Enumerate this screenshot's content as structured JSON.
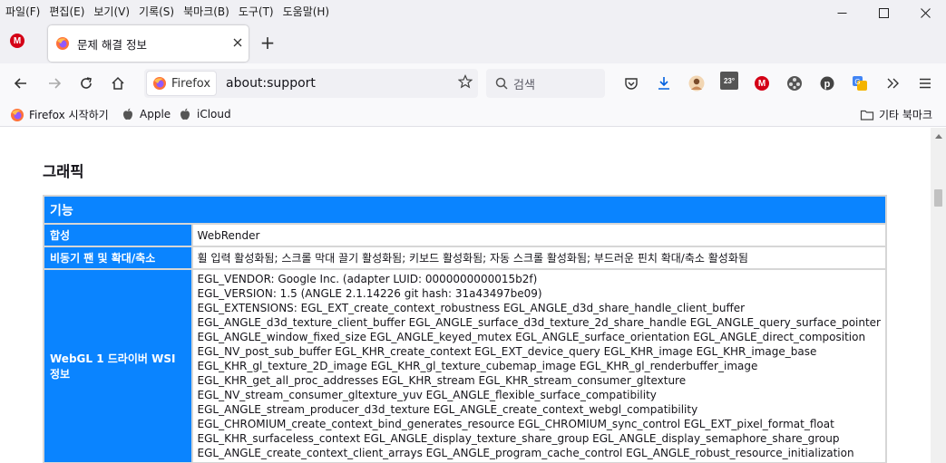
{
  "menu": [
    "파일(F)",
    "편집(E)",
    "보기(V)",
    "기록(S)",
    "북마크(B)",
    "도구(T)",
    "도움말(H)"
  ],
  "window_controls": {
    "minimize": "—",
    "maximize": "☐",
    "close": "✕"
  },
  "tab": {
    "title": "문제 해결 정보",
    "close": "✕"
  },
  "new_tab": "+",
  "nav": {
    "identity_label": "Firefox",
    "url": "about:support",
    "search_placeholder": "검색",
    "weather_badge": "23°"
  },
  "bookmarks": [
    {
      "label": "Firefox 시작하기",
      "icon": "firefox-icon"
    },
    {
      "label": "Apple",
      "icon": "apple-icon"
    },
    {
      "label": "iCloud",
      "icon": "apple-icon"
    }
  ],
  "other_bookmarks": "기타 북마크",
  "content": {
    "heading": "그래픽",
    "section_title": "기능",
    "rows": [
      {
        "label": "합성",
        "value": [
          "WebRender"
        ]
      },
      {
        "label": "비동기 팬 및 확대/축소",
        "value": [
          "휠 입력 활성화됨; 스크롤 막대 끌기 활성화됨; 키보드 활성화됨; 자동 스크롤 활성화됨; 부드러운 핀치 확대/축소 활성화됨"
        ]
      },
      {
        "label": "WebGL 1 드라이버 WSI 정보",
        "value": [
          "EGL_VENDOR: Google Inc. (adapter LUID: 0000000000015b2f)",
          "EGL_VERSION: 1.5 (ANGLE 2.1.14226 git hash: 31a43497be09)",
          "EGL_EXTENSIONS: EGL_EXT_create_context_robustness EGL_ANGLE_d3d_share_handle_client_buffer",
          "EGL_ANGLE_d3d_texture_client_buffer EGL_ANGLE_surface_d3d_texture_2d_share_handle EGL_ANGLE_query_surface_pointer",
          "EGL_ANGLE_window_fixed_size EGL_ANGLE_keyed_mutex EGL_ANGLE_surface_orientation EGL_ANGLE_direct_composition",
          "EGL_NV_post_sub_buffer EGL_KHR_create_context EGL_EXT_device_query EGL_KHR_image EGL_KHR_image_base",
          "EGL_KHR_gl_texture_2D_image EGL_KHR_gl_texture_cubemap_image EGL_KHR_gl_renderbuffer_image",
          "EGL_KHR_get_all_proc_addresses EGL_KHR_stream EGL_KHR_stream_consumer_gltexture",
          "EGL_NV_stream_consumer_gltexture_yuv EGL_ANGLE_flexible_surface_compatibility",
          "EGL_ANGLE_stream_producer_d3d_texture EGL_ANGLE_create_context_webgl_compatibility",
          "EGL_CHROMIUM_create_context_bind_generates_resource EGL_CHROMIUM_sync_control EGL_EXT_pixel_format_float",
          "EGL_KHR_surfaceless_context EGL_ANGLE_display_texture_share_group EGL_ANGLE_display_semaphore_share_group",
          "EGL_ANGLE_create_context_client_arrays EGL_ANGLE_program_cache_control EGL_ANGLE_robust_resource_initialization"
        ]
      }
    ]
  },
  "colors": {
    "accent": "#0a84ff",
    "chrome": "#f0f0f4",
    "toolbar": "#f9f9fb"
  }
}
